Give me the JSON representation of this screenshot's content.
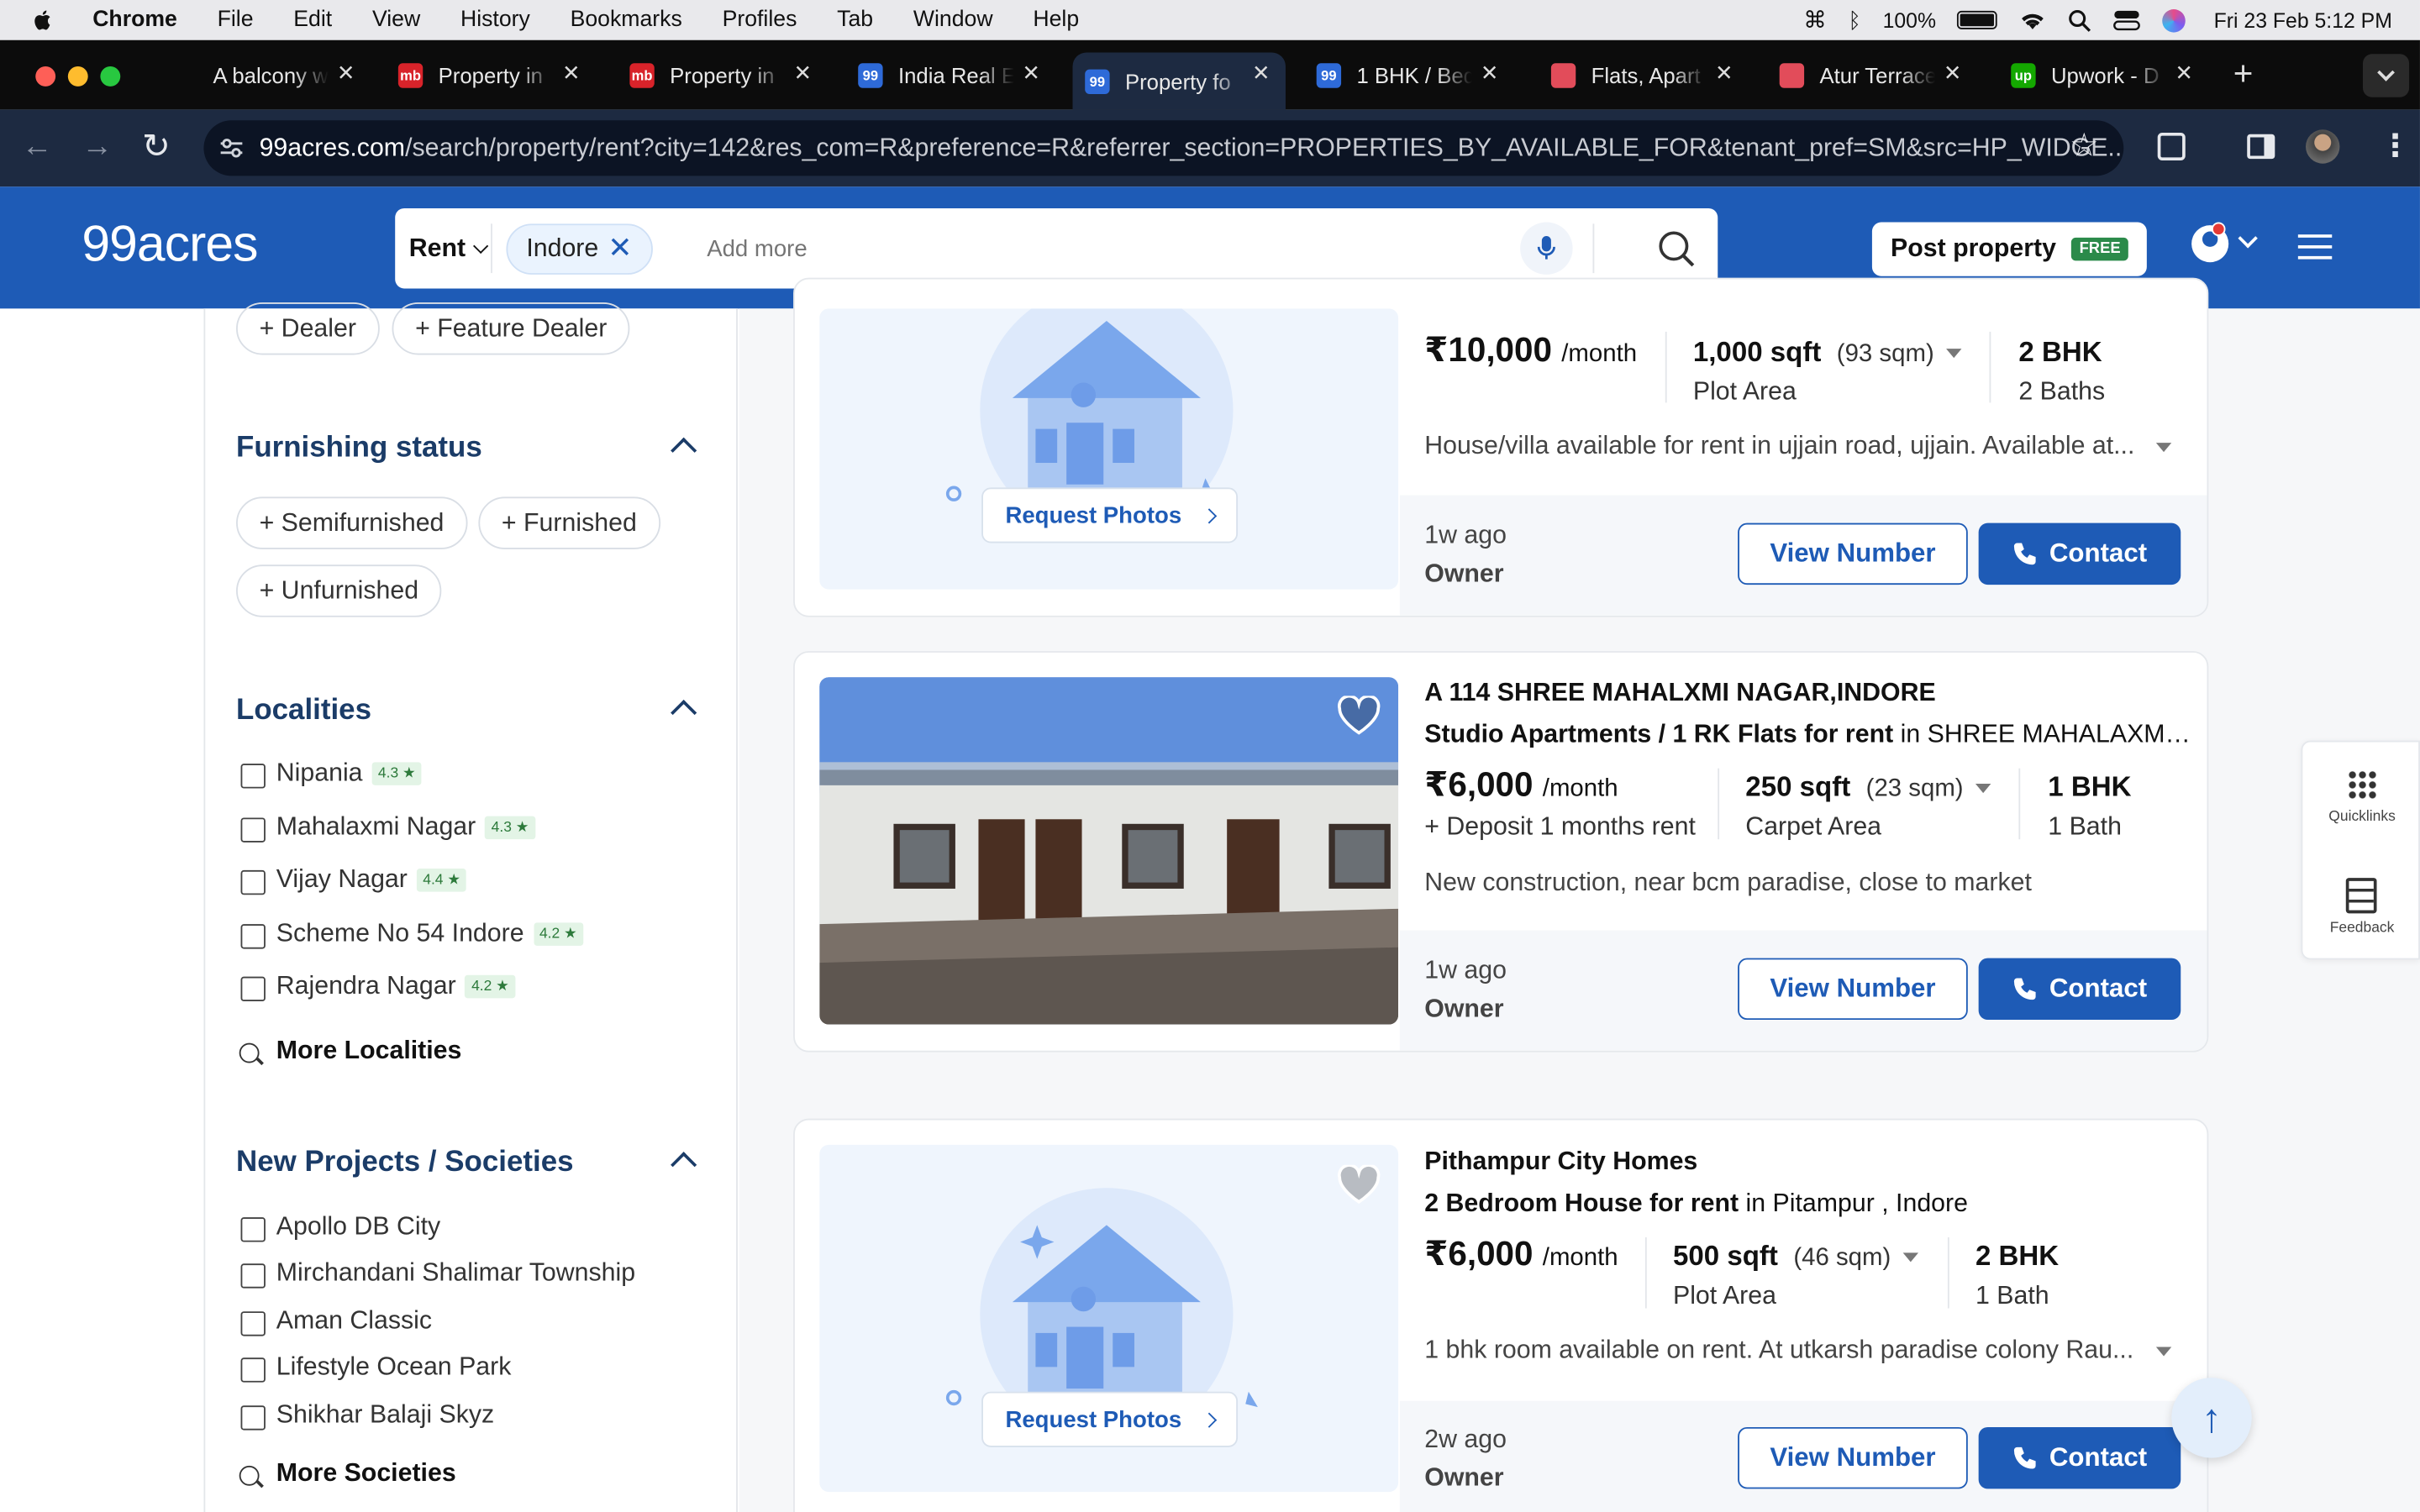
{
  "menubar": {
    "app": "Chrome",
    "items": [
      "File",
      "Edit",
      "View",
      "History",
      "Bookmarks",
      "Profiles",
      "Tab",
      "Window",
      "Help"
    ],
    "battery": "100%",
    "datetime": "Fri 23 Feb  5:12 PM"
  },
  "tabs": [
    {
      "title": "A balcony w",
      "fav": "",
      "color": "#0c0c0c"
    },
    {
      "title": "Property in",
      "fav": "mb",
      "color": "#d8232a"
    },
    {
      "title": "Property in",
      "fav": "mb",
      "color": "#d8232a"
    },
    {
      "title": "India Real E",
      "fav": "99",
      "color": "#2e6ad8"
    },
    {
      "title": "Property fo",
      "fav": "99",
      "color": "#2e6ad8"
    },
    {
      "title": "1 BHK / Bed",
      "fav": "99",
      "color": "#2e6ad8"
    },
    {
      "title": "Flats, Apart",
      "fav": "",
      "color": "#e24c5a"
    },
    {
      "title": "Atur Terrace",
      "fav": "",
      "color": "#e24c5a"
    },
    {
      "title": "Upwork - D",
      "fav": "up",
      "color": "#14a800"
    }
  ],
  "url": {
    "domain": "99acres.com",
    "path": "/search/property/rent?city=142&res_com=R&preference=R&referrer_section=PROPERTIES_BY_AVAILABLE_FOR&tenant_pref=SM&src=HP_WIDGE..."
  },
  "header": {
    "logo": "99acres",
    "mode": "Rent",
    "city_chip": "Indore",
    "search_placeholder": "Add more",
    "post_label": "Post property",
    "free_badge": "FREE"
  },
  "sidebar": {
    "dealer_pills": [
      "+ Dealer",
      "+ Feature Dealer"
    ],
    "furnishing": {
      "title": "Furnishing status",
      "options": [
        "+ Semifurnished",
        "+ Furnished",
        "+ Unfurnished"
      ]
    },
    "localities": {
      "title": "Localities",
      "items": [
        {
          "name": "Nipania",
          "rating": "4.3 ★"
        },
        {
          "name": "Mahalaxmi Nagar",
          "rating": "4.3 ★"
        },
        {
          "name": "Vijay Nagar",
          "rating": "4.4 ★"
        },
        {
          "name": "Scheme No 54 Indore",
          "rating": "4.2 ★"
        },
        {
          "name": "Rajendra Nagar",
          "rating": "4.2 ★"
        }
      ],
      "more": "More Localities"
    },
    "projects": {
      "title": "New Projects / Societies",
      "items": [
        "Apollo DB City",
        "Mirchandani Shalimar Township",
        "Aman Classic",
        "Lifestyle Ocean Park",
        "Shikhar Balaji Skyz"
      ],
      "more": "More Societies"
    }
  },
  "listings": [
    {
      "price": "₹10,000",
      "per": "/month",
      "area": "1,000 sqft",
      "area_alt": "(93 sqm)",
      "area_type": "Plot Area",
      "bhk": "2 BHK",
      "baths": "2 Baths",
      "desc": "House/villa available for rent in ujjain road, ujjain. Available at...",
      "ago": "1w ago",
      "poster": "Owner",
      "request_photos": "Request Photos"
    },
    {
      "name": "A 114 SHREE MAHALXMI NAGAR,INDORE",
      "type": "Studio Apartments / 1 RK Flats for rent",
      "loc": " in SHREE MAHALAXMI NAGA...",
      "price": "₹6,000",
      "per": "/month",
      "deposit": "+ Deposit 1 months rent",
      "area": "250 sqft",
      "area_alt": "(23 sqm)",
      "area_type": "Carpet Area",
      "bhk": "1 BHK",
      "baths": "1 Bath",
      "desc": "New construction, near bcm paradise, close to market",
      "ago": "1w ago",
      "poster": "Owner"
    },
    {
      "name": "Pithampur City Homes",
      "type": "2 Bedroom House for rent",
      "loc": " in Pitampur , Indore",
      "price": "₹6,000",
      "per": "/month",
      "area": "500 sqft",
      "area_alt": "(46 sqm)",
      "area_type": "Plot Area",
      "bhk": "2 BHK",
      "baths": "1 Bath",
      "desc": "1 bhk room available on rent. At utkarsh paradise colony Rau...",
      "ago": "2w ago",
      "poster": "Owner",
      "request_photos": "Request Photos"
    }
  ],
  "buttons": {
    "view_number": "View Number",
    "contact": "Contact"
  },
  "side_tools": {
    "quicklinks": "Quicklinks",
    "feedback": "Feedback"
  },
  "colors": {
    "brand": "#1e5bb6",
    "header": "#1e5bb6"
  }
}
